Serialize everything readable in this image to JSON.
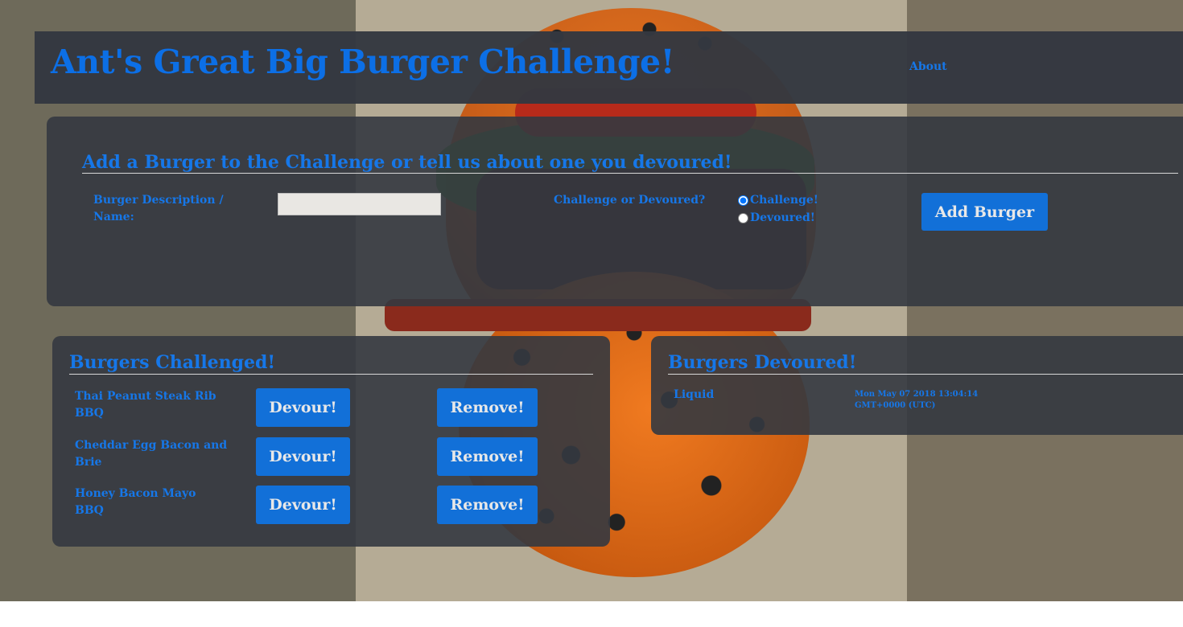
{
  "navbar": {
    "title": "Ant's Great Big Burger Challenge!",
    "about_link": "About"
  },
  "add_form": {
    "heading": "Add a Burger to the Challenge or tell us about one you devoured!",
    "description_label": "Burger Description / Name:",
    "description_value": "",
    "choice_label": "Challenge or Devoured?",
    "option_challenge": "Challenge!",
    "option_devoured": "Devoured!",
    "selected_option": "Challenge!",
    "submit_label": "Add Burger"
  },
  "challenged": {
    "heading": "Burgers Challenged!",
    "devour_label": "Devour!",
    "remove_label": "Remove!",
    "items": [
      {
        "name": "Thai Peanut Steak Rib BBQ"
      },
      {
        "name": "Cheddar Egg Bacon and Brie"
      },
      {
        "name": "Honey Bacon Mayo BBQ"
      }
    ]
  },
  "devoured": {
    "heading": "Burgers Devoured!",
    "items": [
      {
        "name": "Liquid",
        "date": "Mon May 07 2018 13:04:14 GMT+0000 (UTC)"
      }
    ]
  },
  "colors": {
    "accent": "#1677e8",
    "button": "#1270d8",
    "panel": "#343840"
  }
}
